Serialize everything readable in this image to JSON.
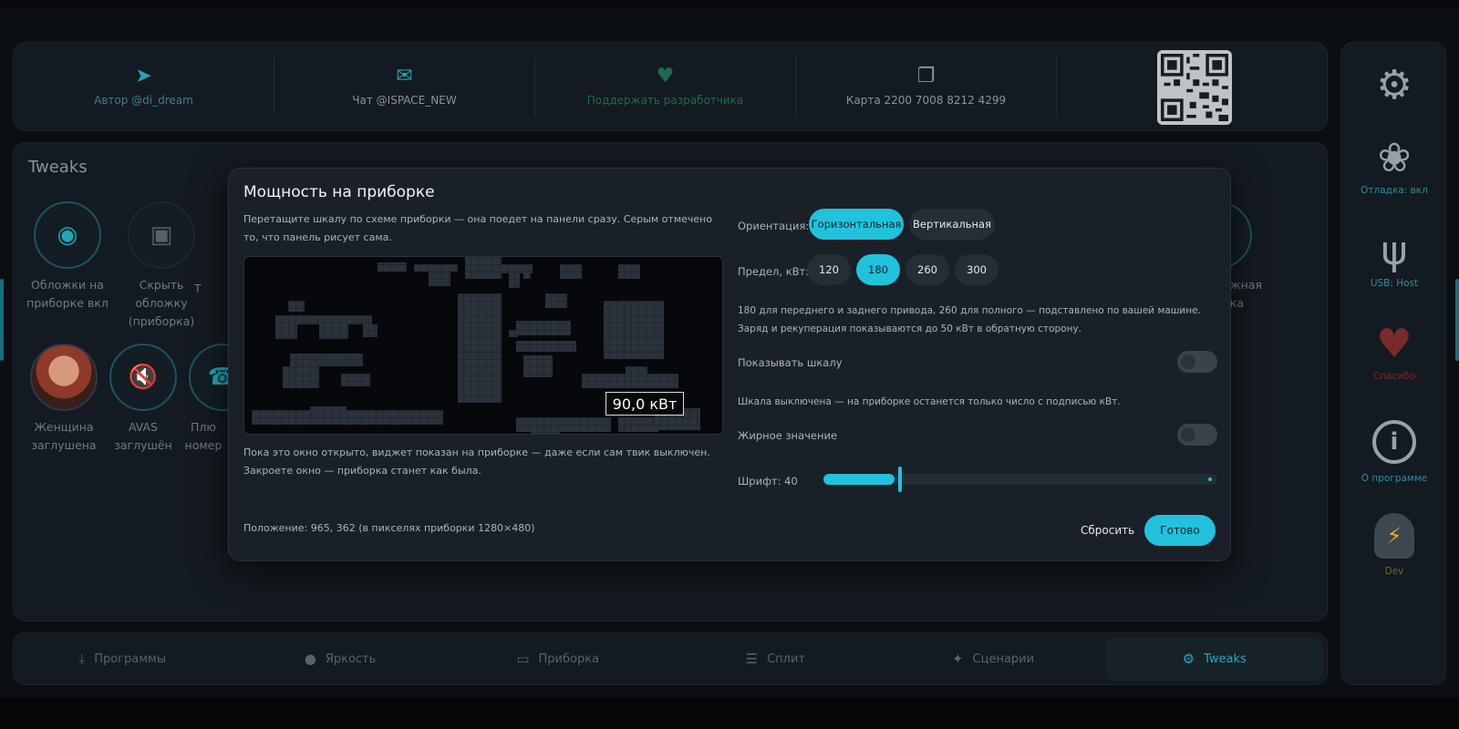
{
  "topbar": {
    "items": [
      {
        "icon": "send-icon",
        "label": "Автор @di_dream"
      },
      {
        "icon": "chat-icon",
        "label": "Чат @ISPACE_NEW"
      },
      {
        "icon": "heart-icon",
        "label": "Поддержать разработчика"
      },
      {
        "icon": "copy-icon",
        "label": "Карта 2200 7008 8212 4299"
      }
    ]
  },
  "tweaks": {
    "title": "Tweaks",
    "items": [
      {
        "label": "Обложки на приборке вкл"
      },
      {
        "label": "Скрыть обложку (приборка)"
      },
      {
        "label": "Т"
      },
      {
        "label": "Женщина заглушена"
      },
      {
        "label": "AVAS заглушён"
      },
      {
        "label": "Плю номер"
      },
      {
        "label": "дажная ойка"
      }
    ]
  },
  "tabs": [
    {
      "icon": "download-icon",
      "label": "Программы",
      "active": false
    },
    {
      "icon": "brightness-icon",
      "label": "Яркость",
      "active": false
    },
    {
      "icon": "dashboard-icon",
      "label": "Приборка",
      "active": false
    },
    {
      "icon": "split-icon",
      "label": "Сплит",
      "active": false
    },
    {
      "icon": "sparkle-icon",
      "label": "Сценарии",
      "active": false
    },
    {
      "icon": "sliders-icon",
      "label": "Tweaks",
      "active": true
    }
  ],
  "sidebar": {
    "items": [
      {
        "icon": "gear-icon",
        "label": ""
      },
      {
        "icon": "bug-icon",
        "label": "Отладка: вкл"
      },
      {
        "icon": "usb-icon",
        "label": "USB: Host"
      },
      {
        "icon": "heart-icon",
        "label": "Спасибо"
      },
      {
        "icon": "info-icon",
        "label": "О программе"
      },
      {
        "icon": "dev-icon",
        "label": "Dev"
      }
    ]
  },
  "modal": {
    "title": "Мощность на приборке",
    "description": "Перетащите шкалу по схеме приборки — она поедет на панели сразу. Серым отмечено то, что панель рисует сама.",
    "preview_value": "90,0 кВт",
    "note": "Пока это окно открыто, виджет показан на приборке — даже если сам твик выключен. Закроете окно — приборка станет как была.",
    "position": "Положение: 965, 362 (в пикселях приборки 1280×480)",
    "orientation_label": "Ориентация:",
    "orientation_options": [
      "Горизонтальная",
      "Вертикальная"
    ],
    "orientation_selected": "Горизонтальная",
    "limit_label": "Предел, кВт:",
    "limit_options": [
      "120",
      "180",
      "260",
      "300"
    ],
    "limit_selected": "180",
    "limit_info": "180 для переднего и заднего привода, 260 для полного — подставлено по вашей машине. Заряд и рекуперация показываются до 50 кВт в обратную сторону.",
    "show_scale_label": "Показывать шкалу",
    "show_scale": false,
    "show_scale_info": "Шкала выключена — на приборке останется только число с подписью кВт.",
    "bold_label": "Жирное значение",
    "bold": false,
    "font_label": "Шрифт: 40",
    "font_value": 40,
    "font_slider_fraction": 0.19,
    "reset_label": "Сбросить",
    "done_label": "Готово"
  },
  "colors": {
    "accent": "#22c1dc",
    "background": "#0b0e12",
    "panel": "#141a21",
    "modal": "#1a2028",
    "heart": "#7a2a2a"
  }
}
